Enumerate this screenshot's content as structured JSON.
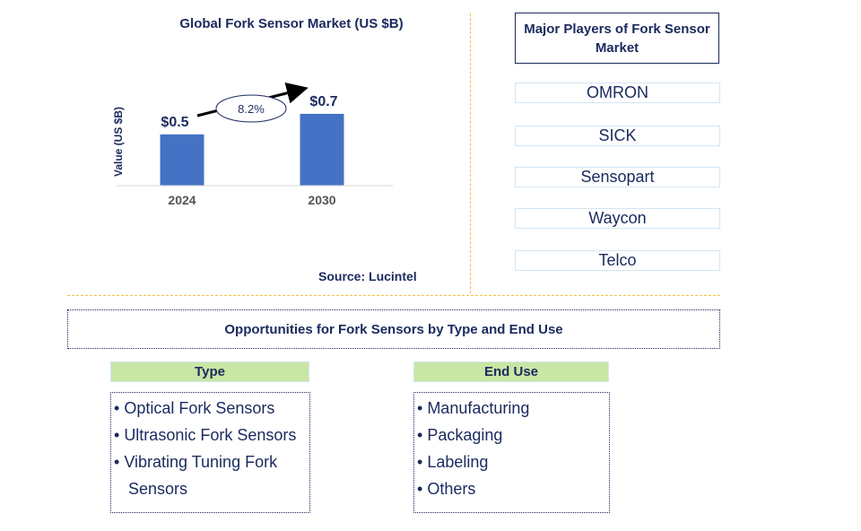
{
  "chart_data": {
    "type": "bar",
    "title": "Global Fork Sensor Market (US $B)",
    "xlabel": "",
    "ylabel": "Value (US $B)",
    "categories": [
      "2024",
      "2030"
    ],
    "values": [
      0.5,
      0.7
    ],
    "data_labels": [
      "$0.5",
      "$0.7"
    ],
    "ylim": [
      0,
      0.75
    ],
    "grid": false,
    "bar_color": "#4472c4",
    "annotation": {
      "type": "cagr-arrow",
      "label": "8.2%",
      "from": "2024",
      "to": "2030"
    }
  },
  "source": "Source: Lucintel",
  "players": {
    "title": "Major Players of Fork Sensor Market",
    "items": [
      "OMRON",
      "SICK",
      "Sensopart",
      "Waycon",
      "Telco"
    ]
  },
  "opportunities": {
    "title": "Opportunities for Fork Sensors by Type and End Use",
    "type": {
      "heading": "Type",
      "items": [
        "Optical Fork Sensors",
        "Ultrasonic Fork Sensors",
        "Vibrating Tuning Fork",
        "Sensors"
      ]
    },
    "end_use": {
      "heading": "End Use",
      "items": [
        "Manufacturing",
        "Packaging",
        "Labeling",
        "Others"
      ]
    }
  },
  "colors": {
    "text": "#1a2a5e",
    "bar": "#4472c4",
    "header_fill": "#c9e6a4",
    "separator": "#f0c040"
  }
}
